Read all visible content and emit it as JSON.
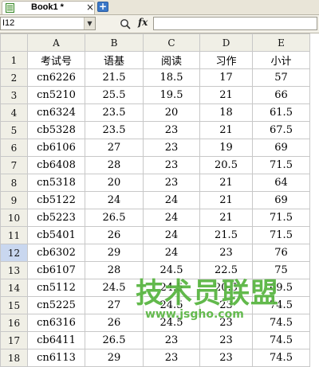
{
  "tab": {
    "title": "Book1 *",
    "close_label": "×",
    "new_tab_label": "+"
  },
  "formula_bar": {
    "name_box": "I12",
    "fx_label": "fx",
    "formula": ""
  },
  "columns": [
    "A",
    "B",
    "C",
    "D",
    "E"
  ],
  "active_row": 12,
  "rows": [
    {
      "num": "1",
      "cells": [
        "考试号",
        "语基",
        "阅读",
        "习作",
        "小计"
      ]
    },
    {
      "num": "2",
      "cells": [
        "cn6226",
        "21.5",
        "18.5",
        "17",
        "57"
      ]
    },
    {
      "num": "3",
      "cells": [
        "cn5210",
        "25.5",
        "19.5",
        "21",
        "66"
      ]
    },
    {
      "num": "4",
      "cells": [
        "cn6324",
        "23.5",
        "20",
        "18",
        "61.5"
      ]
    },
    {
      "num": "5",
      "cells": [
        "cb5328",
        "23.5",
        "23",
        "21",
        "67.5"
      ]
    },
    {
      "num": "6",
      "cells": [
        "cb6106",
        "27",
        "23",
        "19",
        "69"
      ]
    },
    {
      "num": "7",
      "cells": [
        "cb6408",
        "28",
        "23",
        "20.5",
        "71.5"
      ]
    },
    {
      "num": "8",
      "cells": [
        "cn5318",
        "20",
        "23",
        "21",
        "64"
      ]
    },
    {
      "num": "9",
      "cells": [
        "cb5122",
        "24",
        "24",
        "21",
        "69"
      ]
    },
    {
      "num": "10",
      "cells": [
        "cb5223",
        "26.5",
        "24",
        "21",
        "71.5"
      ]
    },
    {
      "num": "11",
      "cells": [
        "cb5401",
        "26",
        "24",
        "21.5",
        "71.5"
      ]
    },
    {
      "num": "12",
      "cells": [
        "cb6302",
        "29",
        "24",
        "23",
        "76"
      ]
    },
    {
      "num": "13",
      "cells": [
        "cb6107",
        "28",
        "24.5",
        "22.5",
        "75"
      ]
    },
    {
      "num": "14",
      "cells": [
        "cn5112",
        "24.5",
        "24.5",
        "20.5",
        "69.5"
      ]
    },
    {
      "num": "15",
      "cells": [
        "cn5225",
        "27",
        "24.5",
        "23",
        "74.5"
      ]
    },
    {
      "num": "16",
      "cells": [
        "cn6316",
        "26",
        "24.5",
        "23",
        "74.5"
      ]
    },
    {
      "num": "17",
      "cells": [
        "cb6411",
        "26.5",
        "23",
        "23",
        "74.5"
      ]
    },
    {
      "num": "18",
      "cells": [
        "cn6113",
        "29",
        "23",
        "23",
        "74.5"
      ]
    }
  ],
  "watermark": {
    "title": "技术员联盟",
    "url": "www.jsgho.com"
  }
}
